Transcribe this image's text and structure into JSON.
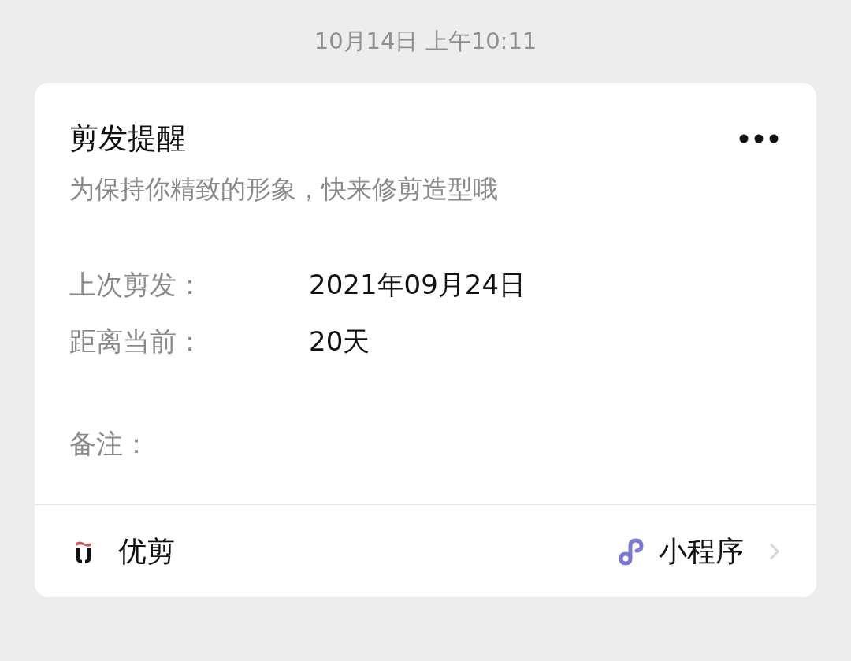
{
  "timestamp": "10月14日 上午10:11",
  "card": {
    "title": "剪发提醒",
    "subtitle": "为保持你精致的形象，快来修剪造型哦",
    "fields": [
      {
        "label": "上次剪发：",
        "value": "2021年09月24日"
      },
      {
        "label": "距离当前：",
        "value": "20天"
      }
    ],
    "remark": {
      "label": "备注："
    },
    "footer": {
      "app_name": "优剪",
      "type_label": "小程序"
    }
  }
}
